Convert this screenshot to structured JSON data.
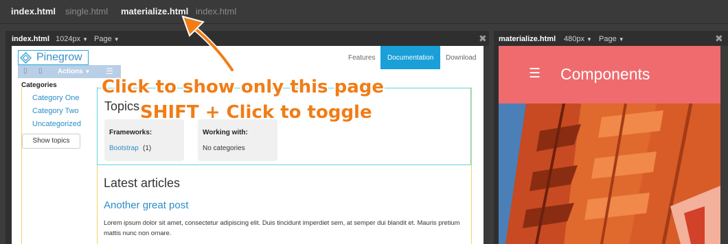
{
  "page_tabs": [
    {
      "label": "index.html",
      "active": true
    },
    {
      "label": "single.html",
      "active": false
    },
    {
      "label": "materialize.html",
      "active": true
    },
    {
      "label": "index.html",
      "active": false
    }
  ],
  "left_panel": {
    "file": "index.html",
    "size": "1024px",
    "mode": "Page",
    "close": "✖",
    "site": {
      "logo_text": "Pinegrow",
      "nav": [
        "Features",
        "Documentation",
        "Download"
      ],
      "actions_label": "Actions",
      "sidebar": {
        "heading": "Categories",
        "items": [
          "Category One",
          "Category Two",
          "Uncategorized"
        ],
        "button": "Show topics"
      },
      "topics": {
        "heading": "Topics",
        "frameworks_label": "Frameworks:",
        "frameworks_link": "Bootstrap",
        "frameworks_count": "(1)",
        "working_label": "Working with:",
        "working_value": "No categories"
      },
      "latest": {
        "heading": "Latest articles",
        "post_title": "Another great post",
        "post_body": "Lorem ipsum dolor sit amet, consectetur adipiscing elit. Duis tincidunt imperdiet sem, at semper dui blandit et. Mauris pretium mattis nunc non ornare."
      }
    }
  },
  "right_panel": {
    "file": "materialize.html",
    "size": "480px",
    "mode": "Page",
    "close": "✖",
    "site": {
      "menu_icon": "hamburger-icon",
      "title": "Components"
    }
  },
  "callout": {
    "line1": "Click to show only this page",
    "line2": "SHIFT + Click to toggle"
  },
  "colors": {
    "accent_blue": "#1a9fd8",
    "material_header": "#ef6b6e",
    "callout_orange": "#f07d17",
    "link_blue": "#2a8dc8"
  }
}
